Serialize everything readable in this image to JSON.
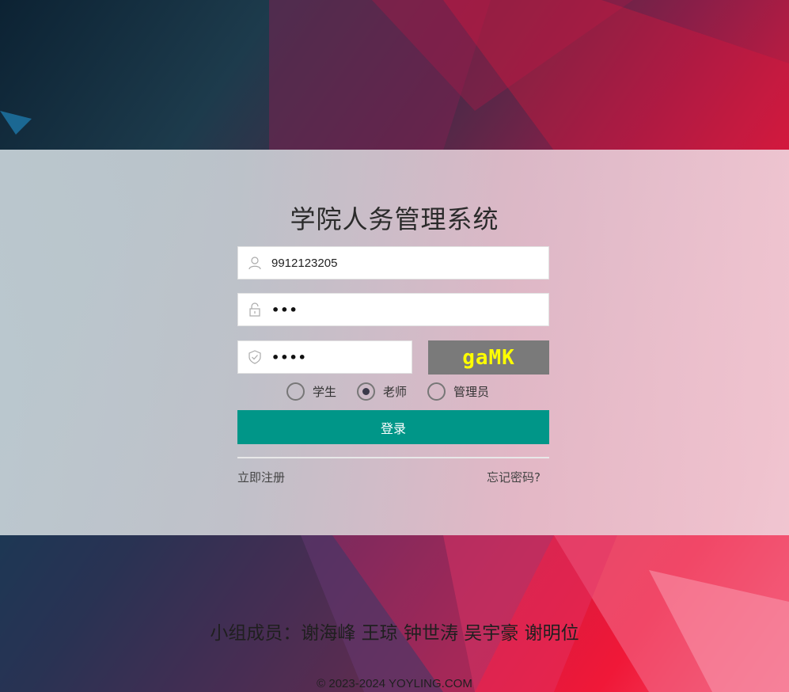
{
  "title": "学院人务管理系统",
  "form": {
    "username_value": "9912123205",
    "password_value": "•••",
    "captcha_input_value": "••••",
    "captcha_text": "gaMK",
    "roles": [
      {
        "label": "学生",
        "selected": false
      },
      {
        "label": "老师",
        "selected": true
      },
      {
        "label": "管理员",
        "selected": false
      }
    ],
    "login_label": "登录",
    "register_label": "立即注册",
    "forgot_label": "忘记密码?"
  },
  "footer": {
    "members": "小组成员：谢海峰 王琼 钟世涛 吴宇豪 谢明位",
    "copyright": "© 2023-2024 YOYLING.COM"
  },
  "colors": {
    "accent": "#009688",
    "captcha_bg": "#7a7a7a",
    "captcha_text": "#ffff00"
  },
  "icons": {
    "username": "user-icon",
    "password": "lock-icon",
    "captcha": "shield-icon"
  }
}
